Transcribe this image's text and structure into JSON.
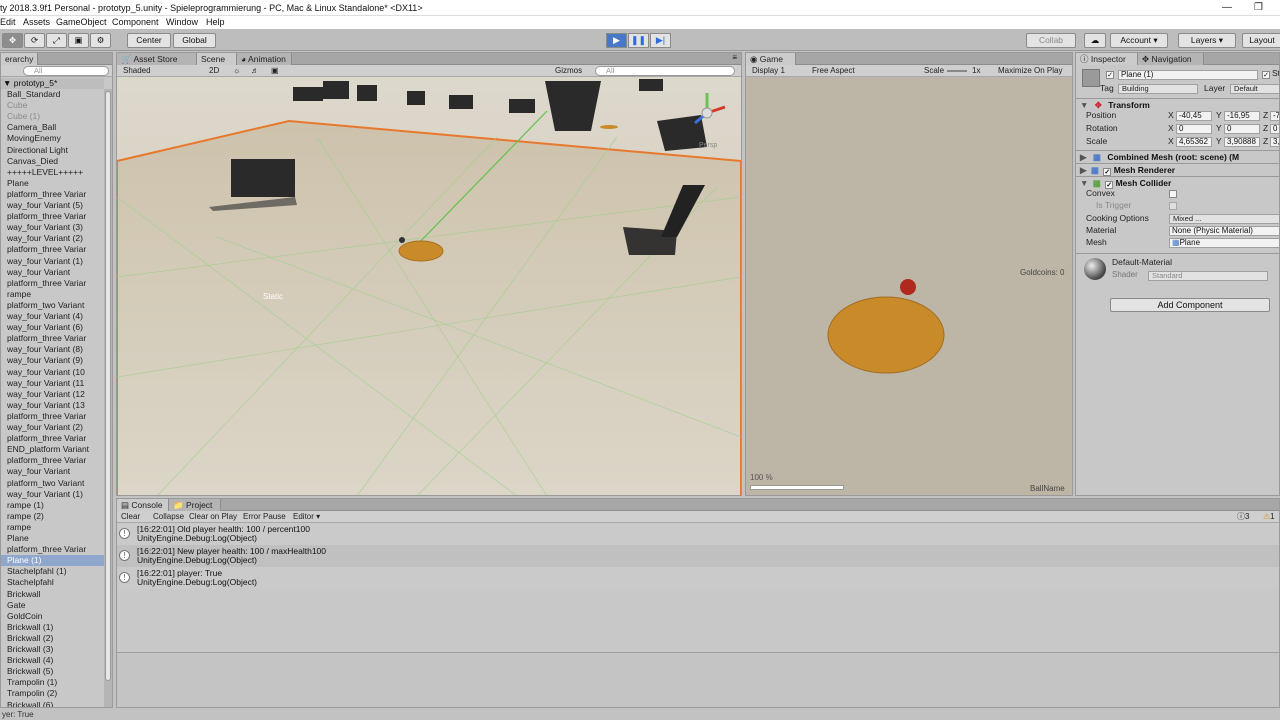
{
  "window": {
    "title": "ty 2018.3.9f1 Personal - prototyp_5.unity - Spieleprogrammierung - PC, Mac & Linux Standalone* <DX11>"
  },
  "menu": [
    "Edit",
    "Assets",
    "GameObject",
    "Component",
    "Window",
    "Help"
  ],
  "toolbar": {
    "pivot": "Center",
    "space": "Global",
    "collab": "Collab",
    "account": "Account",
    "layers": "Layers",
    "layout": "Layout"
  },
  "hierarchy": {
    "tab": "erarchy",
    "search_placeholder": "All",
    "scene_name": "prototyp_5*",
    "items": [
      {
        "label": "Ball_Standard",
        "style": "normal"
      },
      {
        "label": "Cube",
        "style": "grey"
      },
      {
        "label": "Cube (1)",
        "style": "grey"
      },
      {
        "label": "Camera_Ball",
        "style": "normal"
      },
      {
        "label": "MovingEnemy",
        "style": "normal"
      },
      {
        "label": "Directional Light",
        "style": "normal"
      },
      {
        "label": "Canvas_Died",
        "style": "normal"
      },
      {
        "label": "+++++LEVEL+++++",
        "style": "normal"
      },
      {
        "label": "Plane",
        "style": "normal"
      },
      {
        "label": "platform_three Variar",
        "style": "normal"
      },
      {
        "label": "way_four Variant (5)",
        "style": "normal"
      },
      {
        "label": "platform_three Variar",
        "style": "normal"
      },
      {
        "label": "way_four Variant (3)",
        "style": "normal"
      },
      {
        "label": "way_four Variant (2)",
        "style": "normal"
      },
      {
        "label": "platform_three Variar",
        "style": "normal"
      },
      {
        "label": "way_four Variant (1)",
        "style": "normal"
      },
      {
        "label": "way_four Variant",
        "style": "normal"
      },
      {
        "label": "platform_three Variar",
        "style": "normal"
      },
      {
        "label": "rampe",
        "style": "normal"
      },
      {
        "label": "platform_two Variant",
        "style": "normal"
      },
      {
        "label": "way_four Variant (4)",
        "style": "normal"
      },
      {
        "label": "way_four Variant (6)",
        "style": "normal"
      },
      {
        "label": "platform_three Variar",
        "style": "normal"
      },
      {
        "label": "way_four Variant (8)",
        "style": "normal"
      },
      {
        "label": "way_four Variant (9)",
        "style": "normal"
      },
      {
        "label": "way_four Variant (10",
        "style": "normal"
      },
      {
        "label": "way_four Variant (11",
        "style": "normal"
      },
      {
        "label": "way_four Variant (12",
        "style": "normal"
      },
      {
        "label": "way_four Variant (13",
        "style": "normal"
      },
      {
        "label": "platform_three Variar",
        "style": "normal"
      },
      {
        "label": "way_four Variant (2)",
        "style": "normal"
      },
      {
        "label": "platform_three Variar",
        "style": "normal"
      },
      {
        "label": "END_platform Variant",
        "style": "normal"
      },
      {
        "label": "platform_three Variar",
        "style": "normal"
      },
      {
        "label": "way_four Variant",
        "style": "normal"
      },
      {
        "label": "platform_two Variant",
        "style": "normal"
      },
      {
        "label": "way_four Variant (1)",
        "style": "normal"
      },
      {
        "label": "rampe (1)",
        "style": "normal"
      },
      {
        "label": "rampe (2)",
        "style": "normal"
      },
      {
        "label": "rampe",
        "style": "normal"
      },
      {
        "label": "Plane",
        "style": "normal"
      },
      {
        "label": "platform_three Variar",
        "style": "normal"
      },
      {
        "label": "Plane (1)",
        "style": "sel"
      },
      {
        "label": "Stachelpfahl (1)",
        "style": "normal"
      },
      {
        "label": "Stachelpfahl",
        "style": "normal"
      },
      {
        "label": "Brickwall",
        "style": "normal"
      },
      {
        "label": "Gate",
        "style": "normal"
      },
      {
        "label": "GoldCoin",
        "style": "normal"
      },
      {
        "label": "Brickwall (1)",
        "style": "normal"
      },
      {
        "label": "Brickwall (2)",
        "style": "normal"
      },
      {
        "label": "Brickwall (3)",
        "style": "normal"
      },
      {
        "label": "Brickwall (4)",
        "style": "normal"
      },
      {
        "label": "Brickwall (5)",
        "style": "normal"
      },
      {
        "label": "Trampolin (1)",
        "style": "normal"
      },
      {
        "label": "Trampolin (2)",
        "style": "normal"
      },
      {
        "label": "Brickwall (6)",
        "style": "normal"
      }
    ]
  },
  "scene": {
    "tabs": {
      "asset_store": "Asset Store",
      "scene": "Scene",
      "animation": "Animation"
    },
    "draw_mode": "Shaded",
    "mode_2d": "2D",
    "gizmos": "Gizmos",
    "search_placeholder": "All",
    "persp": "Persp",
    "static_label": "Static"
  },
  "game": {
    "tab": "Game",
    "display": "Display 1",
    "aspect": "Free Aspect",
    "scale_label": "Scale",
    "scale_value": "1x",
    "maximize": "Maximize On Play",
    "goldcoins": "Goldcoins: 0",
    "percent": "100 %",
    "ballname": "BallName"
  },
  "inspector": {
    "tabs": {
      "inspector": "Inspector",
      "navigation": "Navigation"
    },
    "object_name": "Plane (1)",
    "static_short": "St",
    "tag_label": "Tag",
    "tag_value": "Building",
    "layer_label": "Layer",
    "layer_value": "Default",
    "transform": {
      "title": "Transform",
      "position_label": "Position",
      "rotation_label": "Rotation",
      "scale_label": "Scale",
      "position": {
        "x": "-40,45",
        "y": "-16,95",
        "z": "-7"
      },
      "rotation": {
        "x": "0",
        "y": "0",
        "z": "0"
      },
      "scale": {
        "x": "4,65362",
        "y": "3,90888",
        "z": "3,"
      }
    },
    "combined_mesh": "Combined Mesh (root: scene) (M",
    "mesh_renderer": "Mesh Renderer",
    "mesh_collider": {
      "title": "Mesh Collider",
      "convex": "Convex",
      "is_trigger": "Is Trigger",
      "cooking_options_label": "Cooking Options",
      "cooking_options_value": "Mixed ...",
      "material_label": "Material",
      "material_value": "None (Physic Material)",
      "mesh_label": "Mesh",
      "mesh_value": "Plane"
    },
    "material": {
      "name": "Default-Material",
      "shader_label": "Shader",
      "shader_value": "Standard"
    },
    "add_component": "Add Component"
  },
  "console": {
    "tabs": {
      "console": "Console",
      "project": "Project"
    },
    "buttons": {
      "clear": "Clear",
      "collapse": "Collapse",
      "clear_on_play": "Clear on Play",
      "error_pause": "Error Pause",
      "editor": "Editor"
    },
    "counts": {
      "info": "3",
      "warn": "1"
    },
    "logs": [
      {
        "line1": "[16:22:01] Old player health: 100 / percent100",
        "line2": "UnityEngine.Debug:Log(Object)"
      },
      {
        "line1": "[16:22:01] New player health: 100 / maxHealth100",
        "line2": "UnityEngine.Debug:Log(Object)"
      },
      {
        "line1": "[16:22:01] player: True",
        "line2": "UnityEngine.Debug:Log(Object)"
      }
    ]
  },
  "statusbar": {
    "text": "yer: True"
  }
}
